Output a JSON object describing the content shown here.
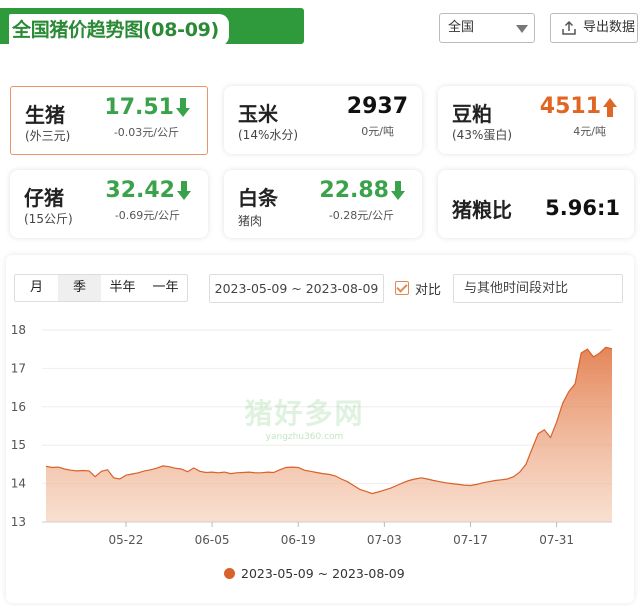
{
  "header": {
    "title": "全国猪价趋势图(08-09)"
  },
  "controls": {
    "region": "全国",
    "export_label": "导出数据"
  },
  "cards": {
    "pig": {
      "name": "生猪",
      "sub": "(外三元)",
      "price": "17.51",
      "change": "-0.03元/公斤",
      "trend": "down"
    },
    "corn": {
      "name": "玉米",
      "sub": "(14%水分)",
      "price": "2937",
      "change": "0元/吨",
      "trend": "flat"
    },
    "soymeal": {
      "name": "豆粕",
      "sub": "(43%蛋白)",
      "price": "4511",
      "change": "4元/吨",
      "trend": "up"
    },
    "piglet": {
      "name": "仔猪",
      "sub": "(15公斤)",
      "price": "32.42",
      "change": "-0.69元/公斤",
      "trend": "down"
    },
    "carcass": {
      "name": "白条",
      "sub": "猪肉",
      "price": "22.88",
      "change": "-0.28元/公斤",
      "trend": "down"
    },
    "ratio": {
      "name": "猪粮比",
      "value": "5.96:1"
    }
  },
  "colors": {
    "brand_green": "#2f9a3c",
    "down_green": "#3aa24a",
    "up_orange": "#e06624",
    "series": "#d9612b"
  },
  "range_tabs": [
    "月",
    "季",
    "半年",
    "一年"
  ],
  "active_range_tab": "季",
  "date_range": "2023-05-09 ~ 2023-08-09",
  "compare": {
    "label": "对比",
    "checked": true,
    "placeholder": "与其他时间段对比"
  },
  "watermark": {
    "main": "猪好多网",
    "sub": "yangzhu360.com"
  },
  "chart_data": {
    "type": "area",
    "title": "",
    "xlabel": "",
    "ylabel": "",
    "ylim": [
      13,
      18
    ],
    "yticks": [
      13,
      14,
      15,
      16,
      17,
      18
    ],
    "xticks": [
      "05-22",
      "06-05",
      "06-19",
      "07-03",
      "07-17",
      "07-31"
    ],
    "x_start": "2023-05-09",
    "x_end": "2023-08-09",
    "grid": true,
    "legend": "bottom",
    "series": [
      {
        "name": "2023-05-09 ~ 2023-08-09",
        "x": [
          "05-09",
          "05-10",
          "05-11",
          "05-12",
          "05-13",
          "05-14",
          "05-15",
          "05-16",
          "05-17",
          "05-18",
          "05-19",
          "05-20",
          "05-21",
          "05-22",
          "05-23",
          "05-24",
          "05-25",
          "05-26",
          "05-27",
          "05-28",
          "05-29",
          "05-30",
          "05-31",
          "06-01",
          "06-02",
          "06-03",
          "06-04",
          "06-05",
          "06-06",
          "06-07",
          "06-08",
          "06-09",
          "06-10",
          "06-11",
          "06-12",
          "06-13",
          "06-14",
          "06-15",
          "06-16",
          "06-17",
          "06-18",
          "06-19",
          "06-20",
          "06-21",
          "06-22",
          "06-23",
          "06-24",
          "06-25",
          "06-26",
          "06-27",
          "06-28",
          "06-29",
          "06-30",
          "07-01",
          "07-02",
          "07-03",
          "07-04",
          "07-05",
          "07-06",
          "07-07",
          "07-08",
          "07-09",
          "07-10",
          "07-11",
          "07-12",
          "07-13",
          "07-14",
          "07-15",
          "07-16",
          "07-17",
          "07-18",
          "07-19",
          "07-20",
          "07-21",
          "07-22",
          "07-23",
          "07-24",
          "07-25",
          "07-26",
          "07-27",
          "07-28",
          "07-29",
          "07-30",
          "07-31",
          "08-01",
          "08-02",
          "08-03",
          "08-04",
          "08-05",
          "08-06",
          "08-07",
          "08-08",
          "08-09"
        ],
        "y": [
          14.45,
          14.42,
          14.43,
          14.38,
          14.35,
          14.33,
          14.34,
          14.33,
          14.18,
          14.32,
          14.36,
          14.15,
          14.12,
          14.22,
          14.25,
          14.28,
          14.33,
          14.36,
          14.4,
          14.46,
          14.44,
          14.4,
          14.38,
          14.31,
          14.41,
          14.32,
          14.29,
          14.3,
          14.28,
          14.3,
          14.26,
          14.28,
          14.29,
          14.3,
          14.28,
          14.28,
          14.3,
          14.29,
          14.36,
          14.42,
          14.43,
          14.42,
          14.35,
          14.32,
          14.29,
          14.26,
          14.24,
          14.2,
          14.12,
          14.05,
          13.95,
          13.85,
          13.8,
          13.74,
          13.78,
          13.83,
          13.88,
          13.95,
          14.02,
          14.08,
          14.12,
          14.15,
          14.12,
          14.08,
          14.05,
          14.02,
          14.0,
          13.98,
          13.96,
          13.95,
          13.98,
          14.02,
          14.05,
          14.08,
          14.1,
          14.12,
          14.18,
          14.3,
          14.5,
          14.9,
          15.3,
          15.4,
          15.2,
          15.6,
          16.1,
          16.4,
          16.6,
          17.4,
          17.5,
          17.3,
          17.4,
          17.55,
          17.51
        ]
      }
    ]
  }
}
